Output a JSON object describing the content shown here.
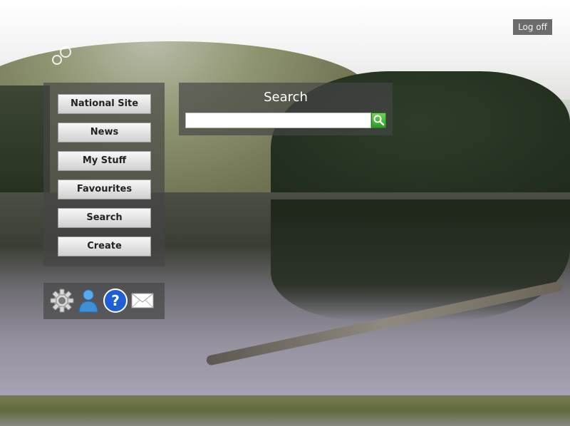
{
  "header": {
    "logoff_label": "Log off"
  },
  "nav": {
    "items": [
      {
        "label": "National Site"
      },
      {
        "label": "News"
      },
      {
        "label": "My Stuff"
      },
      {
        "label": "Favourites"
      },
      {
        "label": "Search"
      },
      {
        "label": "Create"
      }
    ]
  },
  "quick_icons": [
    "gear-icon",
    "user-icon",
    "help-icon",
    "mail-icon"
  ],
  "search": {
    "title": "Search",
    "value": "",
    "button_icon": "magnifier-icon"
  },
  "colors": {
    "panel": "#464646",
    "search_button": "#3aa82e",
    "help_blue": "#1e5fd6"
  }
}
